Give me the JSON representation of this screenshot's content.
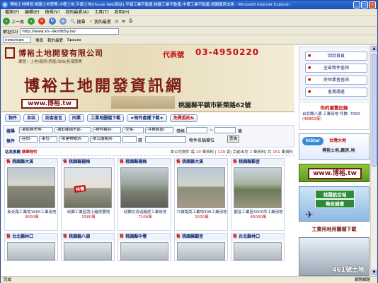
{
  "window": {
    "title": "博裕土地開發,桃園土地買賣,中壢土地,平鎮土地(House Web架站),平鎮工業不動產,桃園工業不動產,中壢工業不動產,桃園廠房出售 - Microsoft Internet Explorer",
    "menu": [
      "檔案(F)",
      "編輯(E)",
      "檢視(V)",
      "我的最愛(A)",
      "工具(T)",
      "說明(H)"
    ],
    "toolbar": {
      "back": "上一頁",
      "search": "搜尋",
      "favorites": "我的最愛"
    },
    "address_label": "網址(D)",
    "address_value": "http://www.xn--9kn8b5y.tw/",
    "links_input": "newviews",
    "links": [
      "搜尋",
      "我的最愛",
      "Spaces"
    ]
  },
  "status": {
    "text": "完成",
    "zone": "網際網路"
  },
  "banner": {
    "company": "博裕土地開發有限公司",
    "services": "專營：土地/廠房/房屋/法拍/各項買賣",
    "tel_label": "代表號",
    "tel": "03-4950220",
    "headline": "博裕土地開發資訊網",
    "url": "www.博裕.tw",
    "address": "桃園縣平鎮市新榮路62號"
  },
  "nav": {
    "items": [
      "物件",
      "本站",
      "訪客留言",
      "同業",
      "工業地圖檔下載",
      "★物件產權下載★",
      "免費委託&"
    ]
  },
  "search": {
    "label_find": "搜尋",
    "label_condition": "條件",
    "row1": [
      "-選取縣市地-",
      "-選取鄉鎮市區-",
      "-物件類別-",
      "-交易-",
      "-坪數範圍-"
    ],
    "price_label": "價格",
    "tilde": "~",
    "unit_wan": "萬",
    "row2": [
      "-座向-",
      "-車位-",
      "-依建物類別-",
      "-依公園類別-"
    ],
    "floor_label": "層",
    "name_label": "物件名稱欄位",
    "search_button": "查詢"
  },
  "reco": {
    "title": "站長推薦",
    "hot": "精華物件",
    "stats_prefix": "本公司物件 每",
    "stats": [
      {
        "n": "20",
        "unit": "筆資料"
      },
      {
        "n": "129",
        "unit": "筆資料"
      },
      {
        "n": "2",
        "unit": "筆資料"
      },
      {
        "n": "151",
        "unit": "筆資料"
      }
    ],
    "stats_labels": [
      "筆資料 ",
      "頁",
      "目前出坊",
      "共"
    ]
  },
  "cards": [
    {
      "tag": "售",
      "title": "桃園縣大溪",
      "desc": "新光路工業地1600工業用地",
      "price": "9500萬",
      "badge": ""
    },
    {
      "tag": "售",
      "title": "桃園縣楊梅",
      "desc": "幼獅工業區旁小廠房農地",
      "price": "1580萬",
      "badge": "特價"
    },
    {
      "tag": "售",
      "title": "桃園縣楊梅",
      "desc": "幼獅交流道廠房工業用地",
      "price": "7100萬",
      "badge": ""
    },
    {
      "tag": "售",
      "title": "桃園縣大溪",
      "desc": "介壽路旁工業地308工業用地",
      "price": "1500萬",
      "badge": ""
    },
    {
      "tag": "售",
      "title": "桃園縣觀音",
      "desc": "觀音工業區5000坪工業用地",
      "price": "45000萬",
      "badge": ""
    }
  ],
  "cards_row2": [
    {
      "tag": "售",
      "title": "台北縣林口"
    },
    {
      "tag": "售",
      "title": "桃園縣八德"
    },
    {
      "tag": "售",
      "title": "桃園縣中壢"
    },
    {
      "tag": "售",
      "title": "桃園縣觀音"
    },
    {
      "tag": "售",
      "title": "台北縣林口"
    }
  ],
  "sidebar": {
    "menu": [
      "回到首頁",
      "全省物件查詢",
      "房仲業者查詢",
      "會員請進"
    ],
    "history_title": "你的瀏覽記錄",
    "history_item": "台北縣八德 工業用地 坪數: 7000",
    "history_price": "(48860萬)",
    "ad1_logo": "hiStar",
    "ad1_t1": "台灣大地",
    "ad1_t2": "博裕土地,廠房,地",
    "ad2": "www.博裕.tw",
    "ad3_l1": "桃園航空城",
    "ad3_l2": "徵收補償",
    "ad4": "工業用地用圖檔下載",
    "ad5": "461號土地"
  }
}
